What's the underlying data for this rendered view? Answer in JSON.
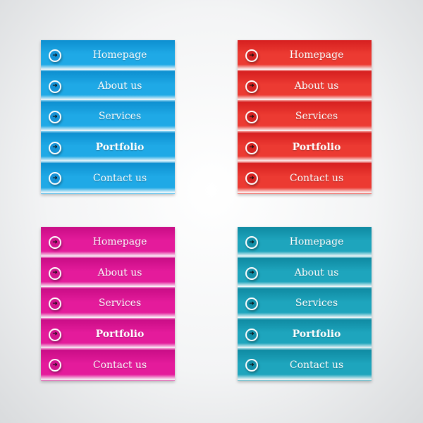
{
  "menus": [
    {
      "id": "blue",
      "color": "#1fa9e6",
      "color_dark": "#0d8fd0",
      "icon_fill": "#1592d6",
      "items": [
        {
          "label": "Homepage",
          "icon": "arrow-right-circle-icon"
        },
        {
          "label": "About us",
          "icon": "arrow-right-circle-icon"
        },
        {
          "label": "Services",
          "icon": "arrow-right-circle-icon"
        },
        {
          "label": "Portfolio",
          "icon": "arrow-right-circle-icon",
          "bold": true
        },
        {
          "label": "Contact us",
          "icon": "arrow-right-circle-icon"
        }
      ]
    },
    {
      "id": "red",
      "color": "#ec3a32",
      "color_dark": "#d61f1f",
      "icon_fill": "#d42222",
      "items": [
        {
          "label": "Homepage",
          "icon": "arrow-right-circle-icon"
        },
        {
          "label": "About us",
          "icon": "arrow-right-circle-icon"
        },
        {
          "label": "Services",
          "icon": "arrow-right-circle-icon"
        },
        {
          "label": "Portfolio",
          "icon": "arrow-right-circle-icon",
          "bold": true
        },
        {
          "label": "Contact us",
          "icon": "arrow-right-circle-icon"
        }
      ]
    },
    {
      "id": "pink",
      "color": "#e41b9b",
      "color_dark": "#c90d86",
      "icon_fill": "#d0168e",
      "items": [
        {
          "label": "Homepage",
          "icon": "arrow-right-circle-icon"
        },
        {
          "label": "About us",
          "icon": "arrow-right-circle-icon"
        },
        {
          "label": "Services",
          "icon": "arrow-right-circle-icon"
        },
        {
          "label": "Portfolio",
          "icon": "arrow-right-circle-icon",
          "bold": true
        },
        {
          "label": "Contact us",
          "icon": "arrow-right-circle-icon"
        }
      ]
    },
    {
      "id": "teal",
      "color": "#1ea5bd",
      "color_dark": "#0f8aa2",
      "icon_fill": "#128fa8",
      "items": [
        {
          "label": "Homepage",
          "icon": "arrow-right-circle-icon"
        },
        {
          "label": "About us",
          "icon": "arrow-right-circle-icon"
        },
        {
          "label": "Services",
          "icon": "arrow-right-circle-icon"
        },
        {
          "label": "Portfolio",
          "icon": "arrow-right-circle-icon",
          "bold": true
        },
        {
          "label": "Contact us",
          "icon": "arrow-right-circle-icon"
        }
      ]
    }
  ]
}
